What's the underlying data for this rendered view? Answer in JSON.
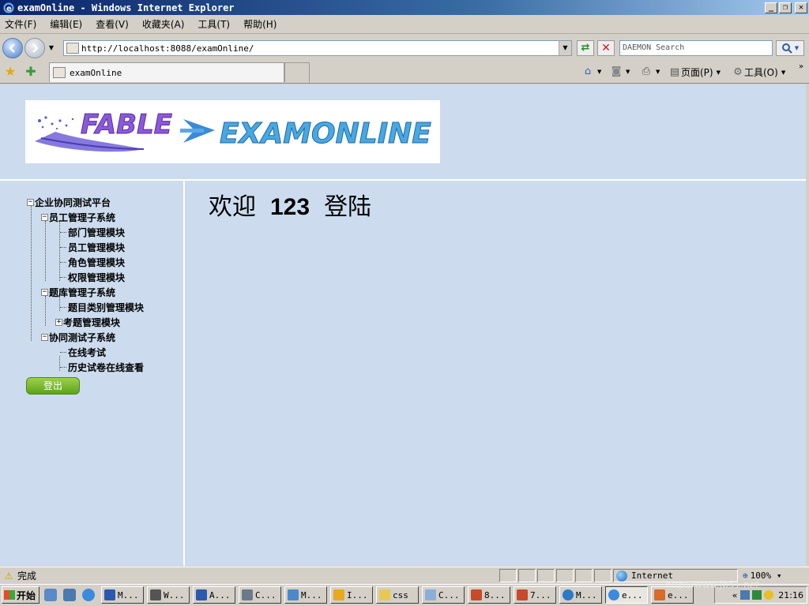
{
  "window": {
    "title": "examOnline - Windows Internet Explorer",
    "minimize": "_",
    "maximize": "❐",
    "close": "✕"
  },
  "menu": [
    "文件(F)",
    "编辑(E)",
    "查看(V)",
    "收藏夹(A)",
    "工具(T)",
    "帮助(H)"
  ],
  "address": {
    "url": "http://localhost:8088/examOnline/",
    "search_placeholder": "DAEMON Search"
  },
  "tab": {
    "label": "examOnline"
  },
  "commands": {
    "page": "页面(P)",
    "tools": "工具(O)"
  },
  "logo": {
    "left_text": "FABLE",
    "right_text": "EXAMONLINE"
  },
  "tree": {
    "root": "企业协同测试平台",
    "groups": [
      {
        "label": "员工管理子系统",
        "items": [
          "部门管理模块",
          "员工管理模块",
          "角色管理模块",
          "权限管理模块"
        ]
      },
      {
        "label": "题库管理子系统",
        "items": [
          "题目类别管理模块",
          "考题管理模块"
        ]
      },
      {
        "label": "协同测试子系统",
        "items": [
          "在线考试",
          "历史试卷在线查看"
        ]
      }
    ]
  },
  "logout_label": "登出",
  "welcome": {
    "prefix": "欢迎",
    "username": "123",
    "suffix": "登陆"
  },
  "status": {
    "text": "完成",
    "zone": "Internet",
    "zoom": "100%"
  },
  "taskbar": {
    "start": "开始",
    "tasks": [
      "M...",
      "W...",
      "A...",
      "C...",
      "M...",
      "I...",
      "css",
      "C...",
      "8...",
      "7...",
      "M...",
      "e...",
      "e..."
    ],
    "clock": "21:16"
  },
  "watermark": "http://www.jb51.net",
  "colors": {
    "content_bg": "#ccdcee",
    "logout_green": "#6cb020",
    "title_bar": "#0a246a"
  }
}
